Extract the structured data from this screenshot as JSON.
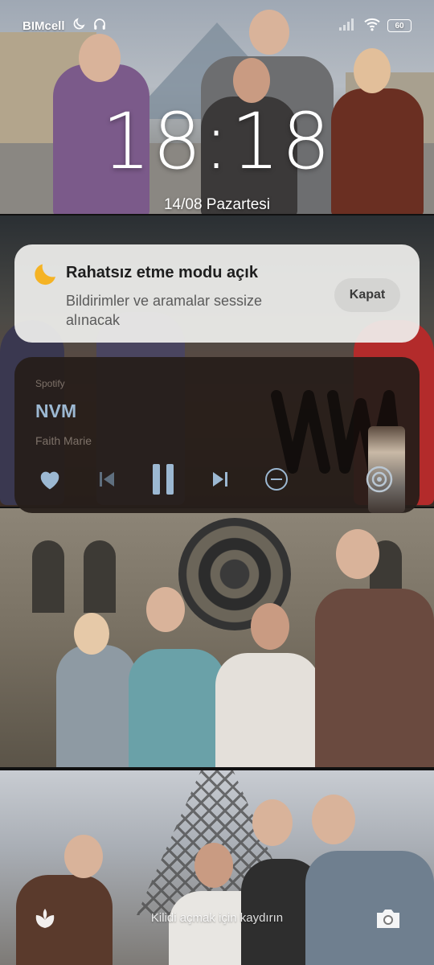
{
  "status_bar": {
    "carrier": "BIMcell",
    "battery_level": "60",
    "icons": [
      "moon-icon",
      "headphones-icon",
      "signal-icon",
      "wifi-icon",
      "battery-icon"
    ]
  },
  "lock_screen": {
    "time": "18:18",
    "date": "14/08 Pazartesi",
    "swipe_hint": "Kilidi açmak için kaydırın"
  },
  "dnd_notification": {
    "title": "Rahatsız etme modu açık",
    "body": "Bildirimler ve aramalar sessize alınacak",
    "button_label": "Kapat",
    "icon": "moon-icon",
    "icon_color": "#f5b324"
  },
  "media_player": {
    "app": "Spotify",
    "title": "NVM",
    "artist": "Faith Marie",
    "accent_color": "#9cb8d2",
    "controls": [
      "heart-icon",
      "previous-icon",
      "pause-icon",
      "next-icon",
      "minus-circle-icon",
      "cast-icon"
    ]
  }
}
